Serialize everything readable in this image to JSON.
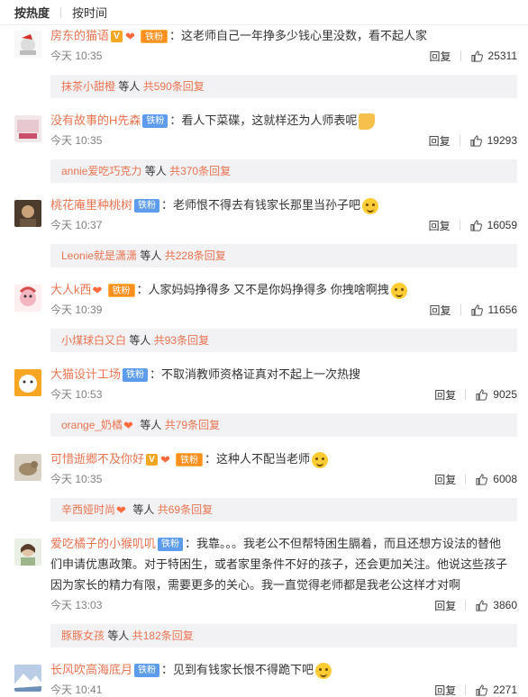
{
  "tabs": {
    "hot": "按热度",
    "time": "按时间"
  },
  "comments": [
    {
      "user": "房东的猫语",
      "verified": true,
      "fan_badge": "铁粉",
      "heart_badge": true,
      "text": "：这老师自己一年挣多少钱心里没数，看不起人家",
      "time": "今天 10:35",
      "reply": "回复",
      "likes": "25311",
      "sub_user": "抹茶小甜橙",
      "sub_etc": "等人",
      "sub_count": "共590条回复",
      "emoji": ""
    },
    {
      "user": "没有故事的H先森",
      "fan_badge": "铁粉",
      "text": "：看人下菜碟，这就样还为人师表呢",
      "time": "今天 10:35",
      "reply": "回复",
      "likes": "19293",
      "sub_user": "annie爱吃巧克力",
      "sub_etc": "等人",
      "sub_count": "共370条回复",
      "emoji": "thumbs-down"
    },
    {
      "user": "桃花庵里种桃树",
      "fan_badge": "铁粉",
      "text": "：老师恨不得去有钱家长那里当孙子吧",
      "time": "今天 10:37",
      "reply": "回复",
      "likes": "16059",
      "sub_user": "Leonie就是潇潇",
      "sub_etc": "等人",
      "sub_count": "共228条回复",
      "emoji": "face"
    },
    {
      "user": "大人k西",
      "fan_badge": "铁粉",
      "heart_badge": true,
      "text": "：人家妈妈挣得多 又不是你妈挣得多 你拽啥啊拽",
      "time": "今天 10:39",
      "reply": "回复",
      "likes": "11656",
      "sub_user": "小煤球白又白",
      "sub_etc": "等人",
      "sub_count": "共93条回复",
      "emoji": "face"
    },
    {
      "user": "大猫设计工场",
      "fan_badge": "铁粉",
      "text": "：不取消教师资格证真对不起上一次热搜",
      "time": "今天 10:53",
      "reply": "回复",
      "likes": "9025",
      "sub_user": "orange_奶橘",
      "sub_heart": true,
      "sub_etc": "等人",
      "sub_count": "共79条回复",
      "emoji": ""
    },
    {
      "user": "可惜逝郷不及你好",
      "verified": true,
      "fan_badge": "铁粉",
      "heart_badge": true,
      "text": "：这种人不配当老师",
      "time": "今天 10:35",
      "reply": "回复",
      "likes": "6008",
      "sub_user": "辛西娅时尚",
      "sub_heart": true,
      "sub_etc": "等人",
      "sub_count": "共69条回复",
      "emoji": "face"
    },
    {
      "user": "爱吃橘子的小猴叽叽",
      "fan_badge": "铁粉",
      "text": "：我靠。。。我老公不但帮特困生膈着，而且还想方设法的替他们申请优惠政策。对于特困生，或者家里条件不好的孩子，还会更加关注。他说这些孩子因为家长的精力有限，需要更多的关心。我一直觉得老师都是我老公这样才对啊",
      "time": "今天 13:03",
      "reply": "回复",
      "likes": "3860",
      "sub_user": "豚豚女孩",
      "sub_etc": "等人",
      "sub_count": "共182条回复",
      "emoji": ""
    },
    {
      "user": "长风吹高海底月",
      "fan_badge": "铁粉",
      "text": "：见到有钱家长恨不得跪下吧",
      "time": "今天 10:41",
      "reply": "回复",
      "likes": "2271",
      "emoji": "face"
    }
  ],
  "colors": {
    "username": "#eb7350",
    "subbox_bg": "#f2f2f5",
    "meta": "#808080"
  }
}
